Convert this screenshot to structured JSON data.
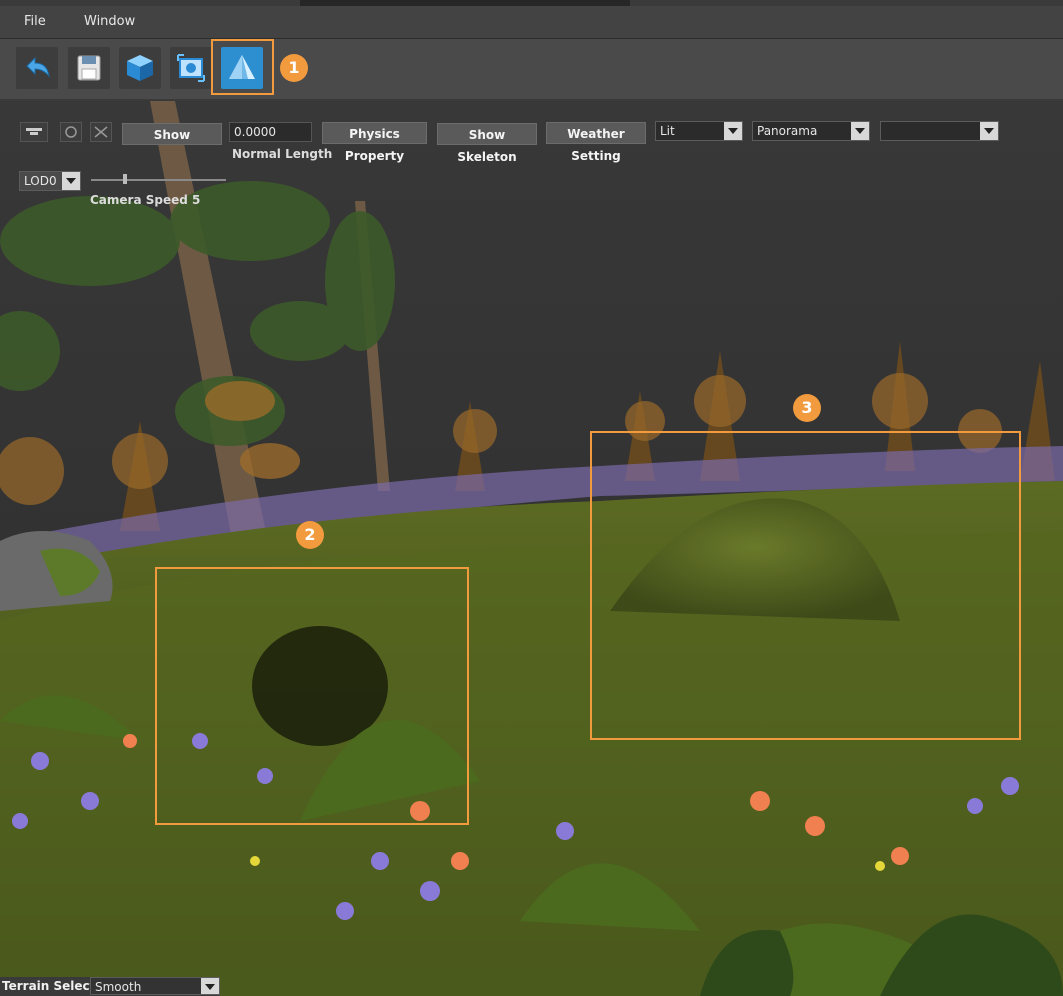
{
  "menu": {
    "file": "File",
    "window": "Window"
  },
  "toolbar": {
    "buttons": [
      {
        "icon": "undo-icon"
      },
      {
        "icon": "save-icon"
      },
      {
        "icon": "cube-icon"
      },
      {
        "icon": "screenshot-icon"
      },
      {
        "icon": "terrain-icon",
        "active": true
      }
    ]
  },
  "callouts": {
    "one": "1",
    "two": "2",
    "three": "3"
  },
  "viewport": {
    "show_label": "Show",
    "normal_length_value": "0.0000",
    "normal_length_label": "Normal Length",
    "physics_property": "Physics Property",
    "show_skeleton": "Show Skeleton",
    "weather_setting": "Weather Setting",
    "lighting_mode": "Lit",
    "background_mode": "Panorama",
    "extra_select": "",
    "lod": "LOD0",
    "camera_speed_label": "Camera Speed 5"
  },
  "terrain": {
    "label": "Terrain Select:",
    "value": "Smooth"
  },
  "colors": {
    "accent": "#f19a3e",
    "active_blue": "#2e8fd0"
  }
}
